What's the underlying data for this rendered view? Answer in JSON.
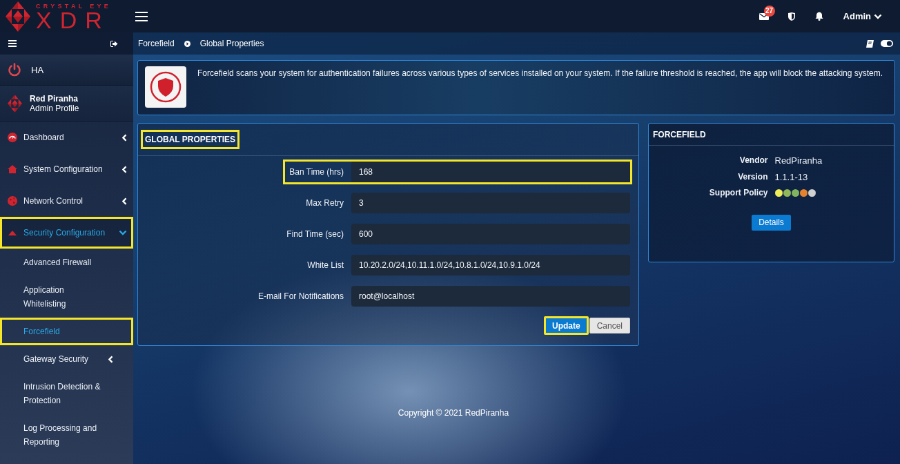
{
  "header": {
    "logo": {
      "tagline": "CRYSTAL EYE",
      "wordmark": "XDR"
    },
    "mail_badge": "27",
    "user": "Admin"
  },
  "sidebar": {
    "status": {
      "label": "HA"
    },
    "profile": {
      "name": "Red Piranha",
      "role": "Admin Profile"
    },
    "items": [
      {
        "label": "Dashboard",
        "kind": "submenu",
        "expanded": false,
        "selected": false,
        "highlighted": false
      },
      {
        "label": "System Configuration",
        "kind": "submenu",
        "expanded": false,
        "selected": false,
        "highlighted": false
      },
      {
        "label": "Network Control",
        "kind": "submenu",
        "expanded": false,
        "selected": false,
        "highlighted": false
      },
      {
        "label": "Security Configuration",
        "kind": "submenu",
        "expanded": true,
        "selected": true,
        "highlighted": true,
        "children": [
          {
            "label": "Advanced Firewall",
            "kind": "link",
            "selected": false,
            "highlighted": false
          },
          {
            "label": "Application Whitelisting",
            "kind": "link",
            "selected": false,
            "highlighted": false
          },
          {
            "label": "Forcefield",
            "kind": "link",
            "selected": true,
            "highlighted": true
          },
          {
            "label": "Gateway Security",
            "kind": "submenu",
            "expanded": false,
            "selected": false,
            "highlighted": false
          },
          {
            "label": "Intrusion Detection & Protection",
            "kind": "link",
            "selected": false,
            "highlighted": false
          },
          {
            "label": "Log Processing and Reporting",
            "kind": "link",
            "selected": false,
            "highlighted": false
          }
        ]
      }
    ]
  },
  "breadcrumb": [
    {
      "label": "Forcefield"
    },
    {
      "label": "Global Properties"
    }
  ],
  "intro": {
    "text": "Forcefield scans your system for authentication failures across various types of services installed on your system. If the failure threshold is reached, the app will block the attacking system."
  },
  "global_properties": {
    "title": "GLOBAL PROPERTIES",
    "highlighted": true,
    "fields": [
      {
        "label": "Ban Time (hrs)",
        "value": "168",
        "highlighted": true
      },
      {
        "label": "Max Retry",
        "value": "3",
        "highlighted": false
      },
      {
        "label": "Find Time (sec)",
        "value": "600",
        "highlighted": false
      },
      {
        "label": "White List",
        "value": "10.20.2.0/24,10.11.1.0/24,10.8.1.0/24,10.9.1.0/24",
        "highlighted": false
      },
      {
        "label": "E-mail For Notifications",
        "value": "root@localhost",
        "highlighted": false
      }
    ],
    "buttons": [
      {
        "label": "Update",
        "kind": "primary",
        "highlighted": true
      },
      {
        "label": "Cancel",
        "kind": "secondary",
        "highlighted": false
      }
    ]
  },
  "app_info": {
    "title": "FORCEFIELD",
    "rows": [
      {
        "kind": "text",
        "label": "Vendor",
        "value": "RedPiranha"
      },
      {
        "kind": "text",
        "label": "Version",
        "value": "1.1.1-13"
      },
      {
        "kind": "dots",
        "label": "Support Policy",
        "dots": [
          {
            "color": "#f0ee58"
          },
          {
            "color": "#92b65a"
          },
          {
            "color": "#80b45e"
          },
          {
            "color": "#e5822f"
          },
          {
            "color": "#d0d0d0"
          }
        ]
      }
    ],
    "button": "Details"
  },
  "footer": {
    "copyright": "Copyright © 2021 RedPiranha"
  }
}
